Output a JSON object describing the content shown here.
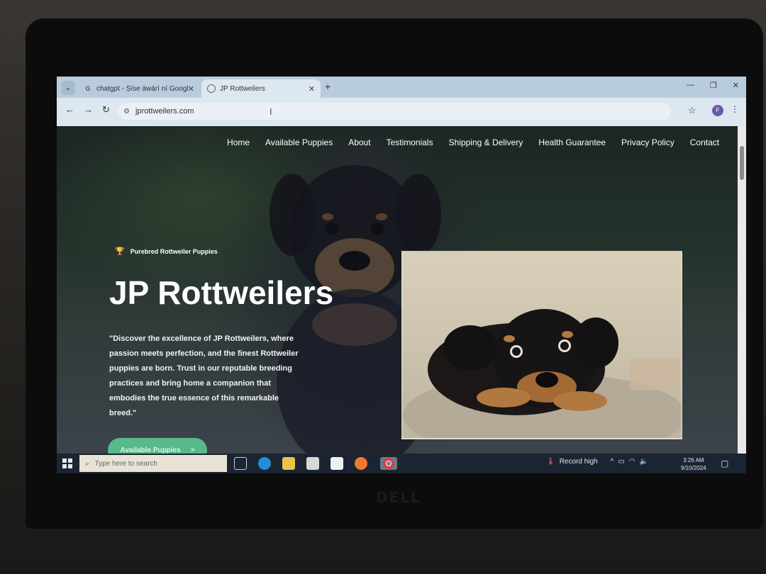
{
  "browser": {
    "tabs": [
      {
        "title": "chatgpt - Ṣíse àwárí ní Google",
        "favicon": "google-icon",
        "active": false
      },
      {
        "title": "JP Rottweilers",
        "favicon": "globe-icon",
        "active": true
      }
    ],
    "url": "jprottweilers.com",
    "profile_initial": "F"
  },
  "site": {
    "nav": [
      "Home",
      "Available Puppies",
      "About",
      "Testimonials",
      "Shipping & Delivery",
      "Health Guarantee",
      "Privacy Policy",
      "Contact"
    ],
    "badge": "Purebred Rottweiler Puppies",
    "title": "JP Rottweilers",
    "description": "\"Discover the excellence of JP Rottweilers, where passion meets perfection, and the finest Rottweiler puppies are born. Trust in our reputable breeding practices and bring home a companion that embodies the true essence of this remarkable breed.\"",
    "cta": "Available Puppies",
    "cta_arrow": ">"
  },
  "taskbar": {
    "search_placeholder": "Type here to search",
    "weather": "Record high",
    "time": "3:26 AM",
    "date": "9/10/2024"
  },
  "hardware": {
    "logo": "DELL"
  },
  "colors": {
    "cta": "#58b98a",
    "trophy": "#e3b437",
    "taskbar": "#1a2433"
  }
}
